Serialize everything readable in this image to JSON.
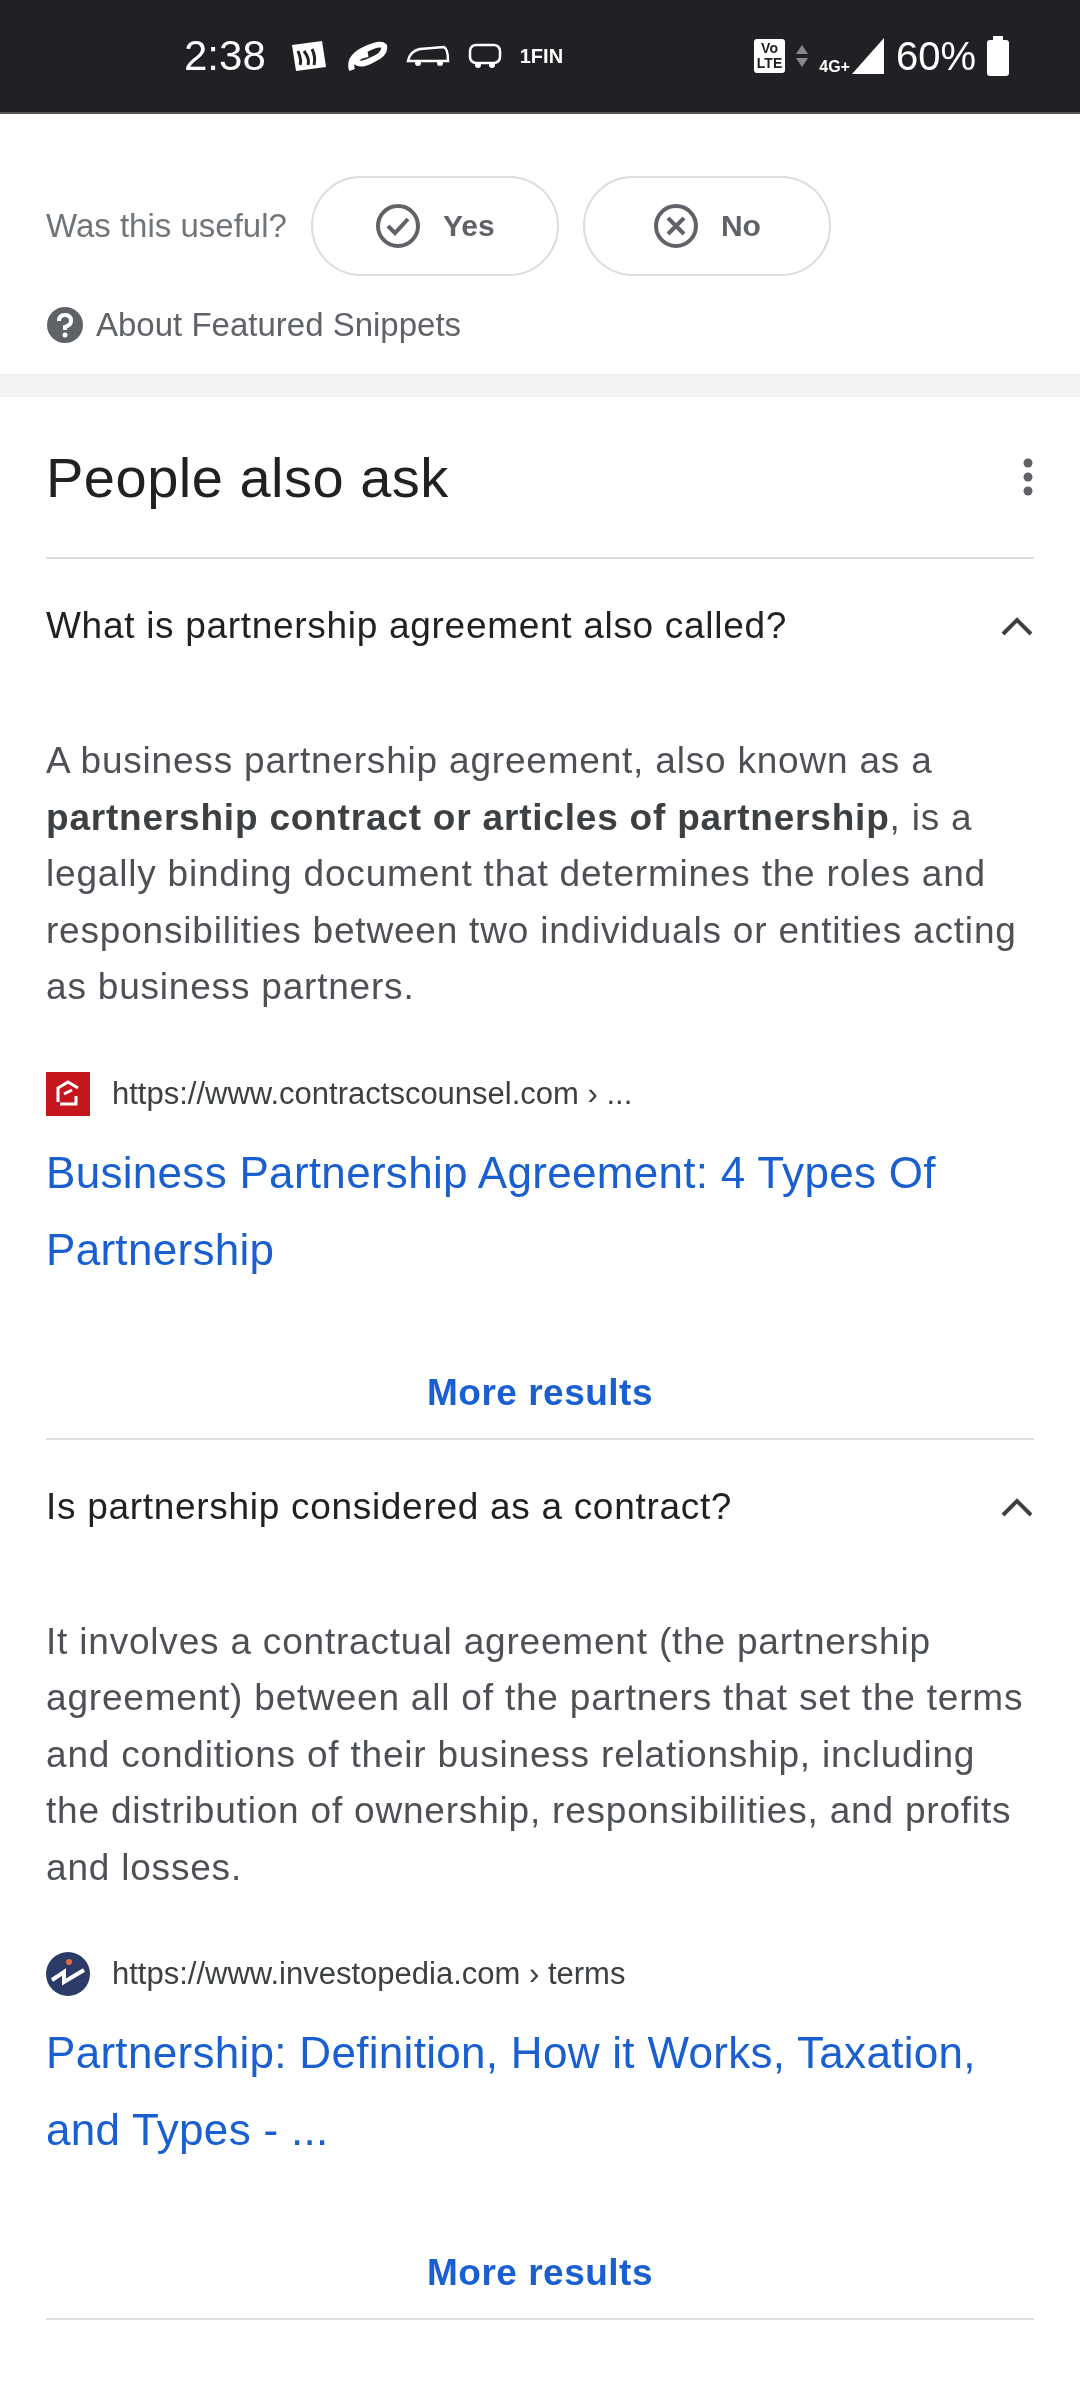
{
  "status_bar": {
    "time": "2:38",
    "app_label": "1FIN",
    "volte": [
      "Vo",
      "LTE"
    ],
    "network": "4G+",
    "battery": "60%"
  },
  "feedback": {
    "question": "Was this useful?",
    "buttons": [
      {
        "label": "Yes",
        "kind": "yes"
      },
      {
        "label": "No",
        "kind": "no"
      }
    ],
    "about": "About Featured Snippets"
  },
  "people_also_ask": {
    "title": "People also ask",
    "items": [
      {
        "question": "What is partnership agreement also called?",
        "expanded": true,
        "answer": "A business partnership agreement, also known as a **partnership contract or articles of partnership**, is a legally binding document that determines the roles and responsibilities between two individuals or entities acting as business partners.",
        "source_url": "https://www.contractscounsel.com › ...",
        "link": "Business Partnership Agreement: 4 Types Of Partnership",
        "more": "More results"
      },
      {
        "question": "Is partnership considered as a contract?",
        "expanded": true,
        "answer": "It involves a contractual agreement (the partnership agreement) between all of the partners that set the terms and conditions of their business relationship, including the distribution of ownership, responsibilities, and profits and losses.",
        "source_url": "https://www.investopedia.com › terms",
        "link": "Partnership: Definition, How it Works, Taxation, and Types - ...",
        "more": "More results"
      }
    ]
  }
}
